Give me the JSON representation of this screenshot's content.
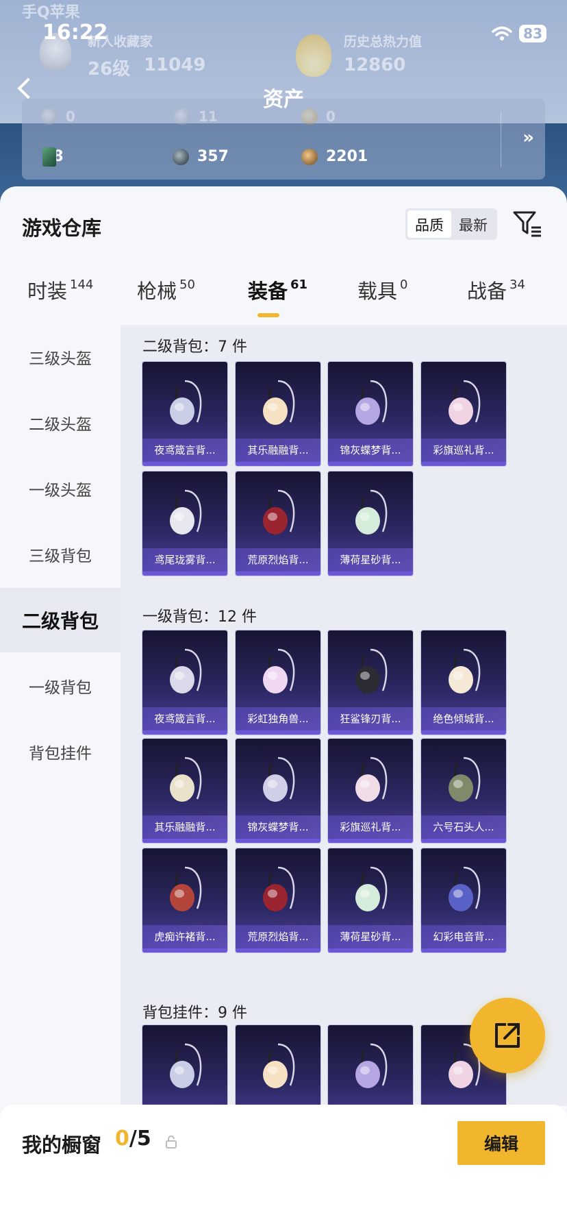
{
  "status_bar": {
    "carrier": "手Q苹果",
    "time": "16:22",
    "battery": "83"
  },
  "profile": {
    "rank_label": "新人收藏家",
    "level": "26级",
    "coins": "11049",
    "heat_label": "历史总热力值",
    "heat_value": "12860",
    "heat_help": "?"
  },
  "assets": {
    "title": "资产",
    "row1": [
      "0",
      "11",
      "0"
    ],
    "row2": [
      "28",
      "357",
      "2201"
    ],
    "more": "»"
  },
  "warehouse": {
    "title": "游戏仓库",
    "sort": [
      "品质",
      "最新"
    ],
    "tabs": [
      {
        "label": "时装",
        "count": "144"
      },
      {
        "label": "枪械",
        "count": "50"
      },
      {
        "label": "装备",
        "count": "61"
      },
      {
        "label": "载具",
        "count": "0"
      },
      {
        "label": "战备",
        "count": "34"
      }
    ],
    "sidebar": [
      "三级头盔",
      "二级头盔",
      "一级头盔",
      "三级背包",
      "二级背包",
      "一级背包",
      "背包挂件"
    ],
    "sections": [
      {
        "title": "二级背包：7 件",
        "items": [
          "夜鸢箴言背...",
          "其乐融融背...",
          "锦灰蝶梦背...",
          "彩旗巡礼背...",
          "鸢尾珑雾背...",
          "荒原烈焰背...",
          "薄荷星砂背..."
        ]
      },
      {
        "title": "一级背包：12 件",
        "items": [
          "夜鸢箴言背...",
          "彩虹独角兽...",
          "狂鲨锋刃背...",
          "绝色倾城背...",
          "其乐融融背...",
          "锦灰蝶梦背...",
          "彩旗巡礼背...",
          "六号石头人...",
          "虎痴许褚背...",
          "荒原烈焰背...",
          "薄荷星砂背...",
          "幻彩电音背..."
        ]
      },
      {
        "title": "背包挂件：9 件",
        "items": [
          "",
          "",
          "",
          ""
        ]
      }
    ]
  },
  "footer": {
    "label": "我的橱窗",
    "current": "0",
    "total": "/5",
    "edit": "编辑"
  },
  "colors": {
    "accent": "#f2b52e",
    "card_top": "#171533",
    "card_bottom": "#4a3f9a"
  }
}
